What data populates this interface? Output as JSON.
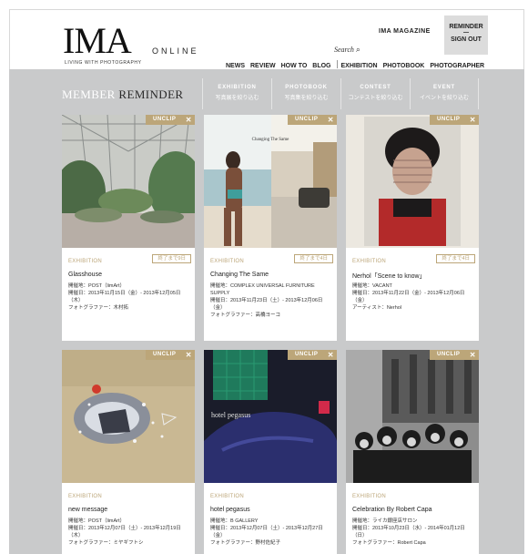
{
  "header": {
    "logo": "IMA",
    "logo_tagline": "LIVING WITH PHOTOGRAPHY",
    "logo_online": "ONLINE",
    "ima_magazine": "IMA MAGAZINE",
    "reminder": "REMINDER",
    "sign_out": "SIGN OUT",
    "search_label": "Search",
    "nav": [
      "NEWS",
      "REVIEW",
      "HOW TO",
      "BLOG",
      "EXHIBITION",
      "PHOTOBOOK",
      "PHOTOGRAPHER"
    ]
  },
  "page": {
    "title_light": "MEMBER",
    "title_dark": "REMINDER",
    "filters": [
      {
        "label": "EXHIBITION",
        "sub": "写真展を絞り込む"
      },
      {
        "label": "PHOTOBOOK",
        "sub": "写真集を絞り込む"
      },
      {
        "label": "CONTEST",
        "sub": "コンテストを絞り込む"
      },
      {
        "label": "EVENT",
        "sub": "イベントを絞り込む"
      }
    ]
  },
  "cards": [
    {
      "unclip": "UNCLIP",
      "category": "EXHIBITION",
      "days": "終了まで9日",
      "title": "Glasshouse",
      "meta": [
        "開催地：POST（limArt）",
        "開催日：2013年11月15日（金）- 2013年12月05日（木）",
        "フォトグラファー：木村拓"
      ]
    },
    {
      "unclip": "UNCLIP",
      "category": "EXHIBITION",
      "days": "終了まで4日",
      "title": "Changing The Same",
      "image_caption": "Changing The Same",
      "meta": [
        "開催地：COMPLEX UNIVERSAL FURNITURE SUPPLY",
        "開催日：2013年11月23日（土）- 2013年12月06日（金）",
        "フォトグラファー：高橋ヨーコ"
      ]
    },
    {
      "unclip": "UNCLIP",
      "category": "EXHIBITION",
      "days": "終了まで4日",
      "title": "Nerhol「Scene to know」",
      "meta": [
        "開催地：VACANT",
        "開催日：2013年11月22日（金）- 2013年12月06日（金）",
        "アーティスト：Nerhol"
      ]
    },
    {
      "unclip": "UNCLIP",
      "category": "EXHIBITION",
      "days": "",
      "title": "new message",
      "meta": [
        "開催地：POST（limArt）",
        "開催日：2013年12月07日（土）- 2013年12月19日（木）",
        "フォトグラファー：ミヤギフトシ"
      ]
    },
    {
      "unclip": "UNCLIP",
      "category": "EXHIBITION",
      "days": "",
      "title": "hotel pegasus",
      "image_caption": "hotel pegasus",
      "meta": [
        "開催地：B GALLERY",
        "開催日：2013年12月07日（土）- 2013年12月27日（金）",
        "フォトグラファー：野村佐紀子"
      ]
    },
    {
      "unclip": "UNCLIP",
      "category": "EXHIBITION",
      "days": "",
      "title": "Celebration By Robert Capa",
      "meta": [
        "開催地：ライカ銀座店サロン",
        "開催日：2013年10月23日（水）- 2014年01月12日（日）",
        "フォトグラファー：Robert Capa"
      ]
    }
  ]
}
